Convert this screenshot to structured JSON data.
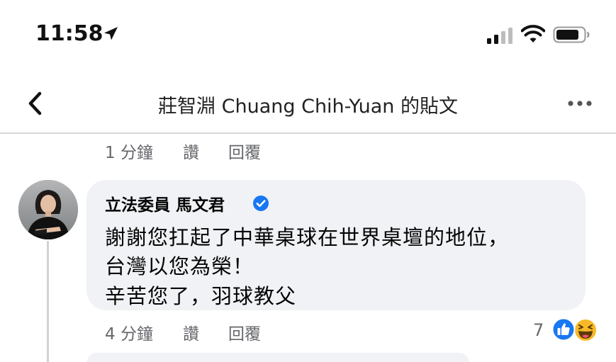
{
  "status_bar": {
    "time": "11:58",
    "location_icon": "location-arrow-icon",
    "signal_icon": "cellular-signal-icon",
    "wifi_icon": "wifi-icon",
    "battery_icon": "battery-icon"
  },
  "header": {
    "back_icon": "chevron-left-icon",
    "title": "莊智淵  Chuang Chih-Yuan 的貼文",
    "more_icon": "more-horizontal-icon"
  },
  "previous_comment_actions": {
    "time": "1 分鐘",
    "like": "讚",
    "reply": "回覆"
  },
  "comment": {
    "author": "立法委員 馬文君",
    "verified_icon": "verified-badge-icon",
    "lines": [
      "謝謝您扛起了中華桌球在世界桌壇的地位，",
      "台灣以您為榮！",
      "辛苦您了，羽球教父"
    ],
    "actions": {
      "time": "4 分鐘",
      "like": "讚",
      "reply": "回覆"
    },
    "reactions": {
      "count": "7",
      "types": [
        "like-reaction-icon",
        "haha-reaction-icon"
      ]
    }
  },
  "colors": {
    "accent": "#1877f2",
    "bubble": "#f0f2f5",
    "secondary_text": "#65676b",
    "haha": "#f7b928"
  }
}
